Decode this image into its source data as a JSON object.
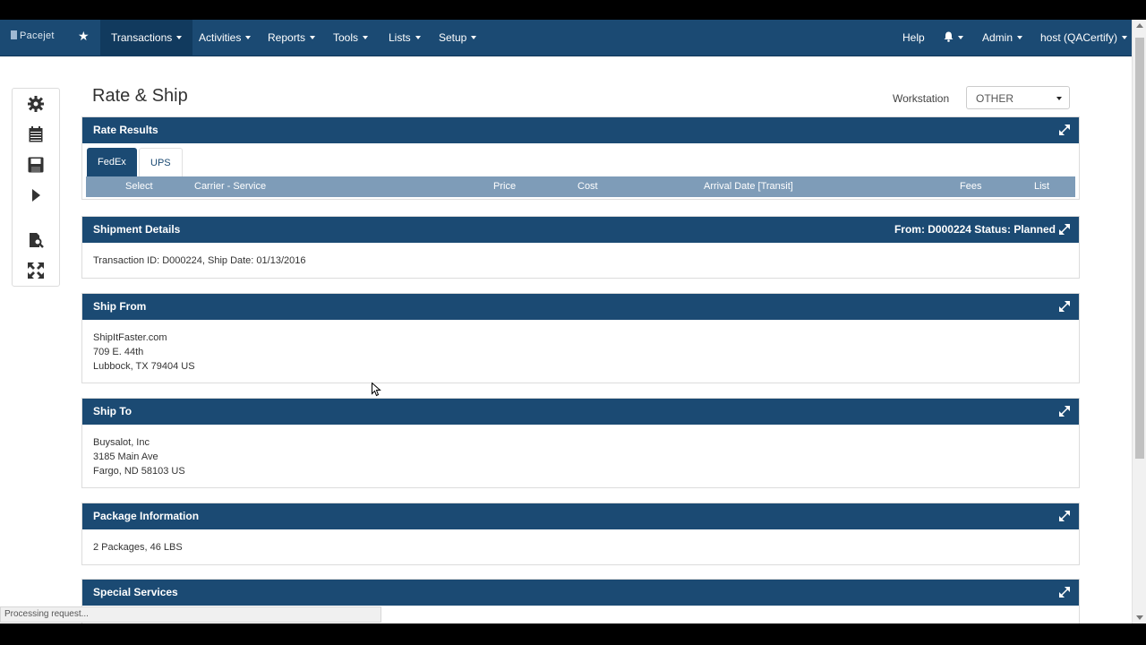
{
  "nav": {
    "logo": "Pacejet",
    "star": "★",
    "items": [
      "Transactions",
      "Activities",
      "Reports",
      "Tools",
      "Lists",
      "Setup"
    ],
    "help": "Help",
    "admin": "Admin",
    "host": "host (QACertify)"
  },
  "page": {
    "title": "Rate & Ship",
    "workstation_label": "Workstation",
    "workstation_value": "OTHER"
  },
  "sidetools": [
    "gear-icon",
    "calendar-icon",
    "save-icon",
    "play-icon",
    "document-search-icon",
    "expand-arrows-icon"
  ],
  "rate_results": {
    "title": "Rate Results",
    "tabs": [
      "FedEx",
      "UPS"
    ],
    "columns": [
      "Select",
      "Carrier - Service",
      "Price",
      "Cost",
      "Arrival Date [Transit]",
      "Fees",
      "List"
    ]
  },
  "shipment_details": {
    "title": "Shipment Details",
    "right": "From: D000224 Status: Planned",
    "line": "Transaction ID: D000224, Ship Date: 01/13/2016"
  },
  "ship_from": {
    "title": "Ship From",
    "lines": [
      "ShipItFaster.com",
      "709 E. 44th",
      "Lubbock, TX 79404 US"
    ]
  },
  "ship_to": {
    "title": "Ship To",
    "lines": [
      "Buysalot, Inc",
      "3185 Main Ave",
      "Fargo, ND 58103 US"
    ]
  },
  "package_info": {
    "title": "Package Information",
    "line": "2 Packages, 46 LBS"
  },
  "special_services": {
    "title": "Special Services"
  },
  "status_bar": "Processing request...",
  "colors": {
    "nav_bg": "#1b4a73",
    "panel_header": "#1b4a73",
    "table_header": "#7e9cb8"
  }
}
